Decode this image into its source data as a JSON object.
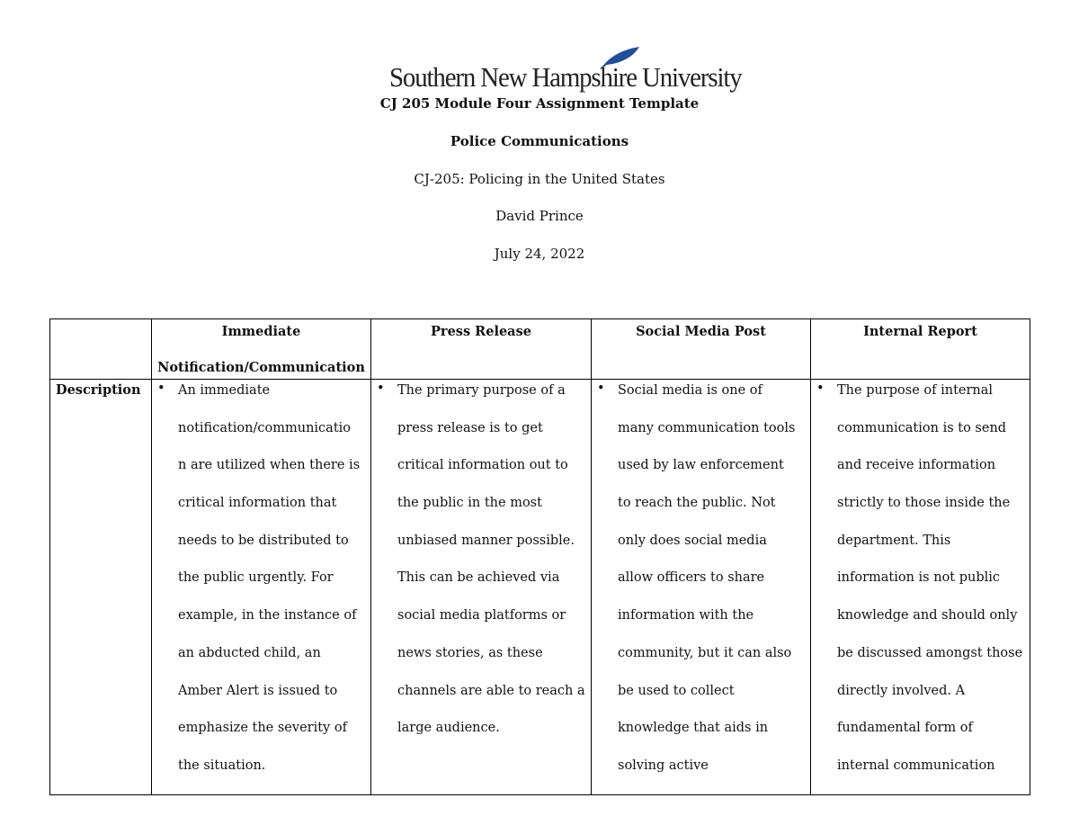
{
  "logo": {
    "text": "Southern New Hampshire University",
    "accent": "#1f4e9a"
  },
  "header": {
    "template_title": "CJ 205 Module Four Assignment Template",
    "title": "Police Communications",
    "course": "CJ-205: Policing in the United States",
    "author": "David Prince",
    "date": "July 24, 2022"
  },
  "table": {
    "columns": [
      {
        "label_lines": [
          "Immediate",
          "Notification/Communication"
        ]
      },
      {
        "label_lines": [
          "Press Release"
        ]
      },
      {
        "label_lines": [
          "Social Media Post"
        ]
      },
      {
        "label_lines": [
          "Internal Report"
        ]
      }
    ],
    "rows": [
      {
        "label": "Description",
        "cells": [
          [
            "An immediate",
            "notification/communicatio",
            "n are utilized when there is",
            "critical information that",
            "needs to be distributed to",
            "the public urgently. For",
            "example, in the instance of",
            "an abducted child, an",
            "Amber Alert is issued to",
            "emphasize the severity of",
            "the situation."
          ],
          [
            "The primary purpose of a",
            "press release is to get",
            "critical information out to",
            "the public in the most",
            "unbiased manner possible.",
            "This can be achieved via",
            "social media platforms or",
            "news stories, as these",
            "channels are able to reach a",
            "large audience."
          ],
          [
            "Social media is one of",
            "many communication tools",
            "used by law enforcement",
            "to reach the public. Not",
            "only does social media",
            "allow officers to share",
            "information with the",
            "community, but it can also",
            "be used to collect",
            "knowledge that aids in",
            "solving active"
          ],
          [
            "The purpose of internal",
            "communication is to send",
            "and receive information",
            "strictly to those inside the",
            "department. This",
            "information is not public",
            "knowledge and should only",
            "be discussed amongst those",
            "directly involved. A",
            "fundamental form of",
            "internal communication"
          ]
        ]
      }
    ]
  }
}
